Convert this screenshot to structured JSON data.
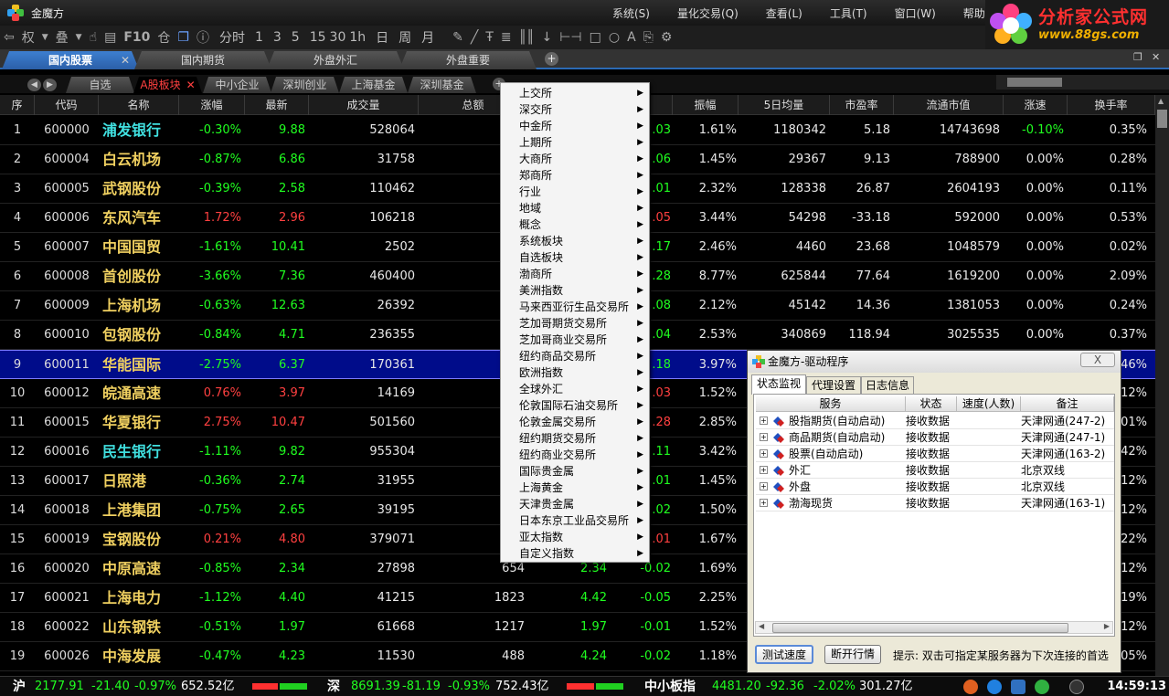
{
  "window": {
    "title": "金魔方"
  },
  "menu": [
    "系统(S)",
    "量化交易(Q)",
    "查看(L)",
    "工具(T)",
    "窗口(W)",
    "帮助"
  ],
  "brand": {
    "name": "分析家公式网",
    "url": "www.88gs.com"
  },
  "toolbar": {
    "left": [
      "权",
      "叠",
      "F10",
      "仓"
    ],
    "periods": [
      "分时",
      "1",
      "3",
      "5",
      "15",
      "30",
      "1h",
      "日",
      "周",
      "月"
    ]
  },
  "main_tabs": [
    {
      "label": "国内股票",
      "active": true
    },
    {
      "label": "国内期货"
    },
    {
      "label": "外盘外汇"
    },
    {
      "label": "外盘重要"
    }
  ],
  "sub_tabs": [
    {
      "label": "自选"
    },
    {
      "label": "A股板块",
      "active": true
    },
    {
      "label": "中小企业"
    },
    {
      "label": "深圳创业"
    },
    {
      "label": "上海基金"
    },
    {
      "label": "深圳基金"
    }
  ],
  "columns": [
    "序",
    "代码",
    "名称",
    "涨幅",
    "最新",
    "成交量",
    "总额",
    "",
    "",
    "振幅",
    "5日均量",
    "市盈率",
    "流通市值",
    "涨速",
    "换手率"
  ],
  "rows": [
    {
      "seq": "1",
      "code": "600000",
      "name": "浦发银行",
      "nc": "cyan",
      "chg": "-0.30%",
      "last": "9.88",
      "vol": "528064",
      "amt": "52",
      "p2": "",
      "d": ".03",
      "amp": "1.61%",
      "avg5": "1180342",
      "pe": "5.18",
      "mv": "14743698",
      "spd": "-0.10%",
      "turn": "0.35%",
      "dir": "g"
    },
    {
      "seq": "2",
      "code": "600004",
      "name": "白云机场",
      "chg": "-0.87%",
      "last": "6.86",
      "vol": "31758",
      "amt": "2",
      "p2": "",
      "d": ".06",
      "amp": "1.45%",
      "avg5": "29367",
      "pe": "9.13",
      "mv": "788900",
      "spd": "0.00%",
      "turn": "0.28%",
      "dir": "g"
    },
    {
      "seq": "3",
      "code": "600005",
      "name": "武钢股份",
      "chg": "-0.39%",
      "last": "2.58",
      "vol": "110462",
      "amt": "2",
      "p2": "",
      "d": ".01",
      "amp": "2.32%",
      "avg5": "128338",
      "pe": "26.87",
      "mv": "2604193",
      "spd": "0.00%",
      "turn": "0.11%",
      "dir": "g"
    },
    {
      "seq": "4",
      "code": "600006",
      "name": "东风汽车",
      "chg": "1.72%",
      "last": "2.96",
      "vol": "106218",
      "amt": "3",
      "p2": "",
      "d": ".05",
      "amp": "3.44%",
      "avg5": "54298",
      "pe": "-33.18",
      "mv": "592000",
      "spd": "0.00%",
      "turn": "0.53%",
      "dir": "rd"
    },
    {
      "seq": "5",
      "code": "600007",
      "name": "中国国贸",
      "chg": "-1.61%",
      "last": "10.41",
      "vol": "2502",
      "amt": "",
      "p2": "",
      "d": ".17",
      "amp": "2.46%",
      "avg5": "4460",
      "pe": "23.68",
      "mv": "1048579",
      "spd": "0.00%",
      "turn": "0.02%",
      "dir": "g"
    },
    {
      "seq": "6",
      "code": "600008",
      "name": "首创股份",
      "chg": "-3.66%",
      "last": "7.36",
      "vol": "460400",
      "amt": "34",
      "p2": "",
      "d": ".28",
      "amp": "8.77%",
      "avg5": "625844",
      "pe": "77.64",
      "mv": "1619200",
      "spd": "0.00%",
      "turn": "2.09%",
      "dir": "g"
    },
    {
      "seq": "7",
      "code": "600009",
      "name": "上海机场",
      "chg": "-0.63%",
      "last": "12.63",
      "vol": "26392",
      "amt": "3",
      "p2": "",
      "d": ".08",
      "amp": "2.12%",
      "avg5": "45142",
      "pe": "14.36",
      "mv": "1381053",
      "spd": "0.00%",
      "turn": "0.24%",
      "dir": "g"
    },
    {
      "seq": "8",
      "code": "600010",
      "name": "包钢股份",
      "chg": "-0.84%",
      "last": "4.71",
      "vol": "236355",
      "amt": "11",
      "p2": "",
      "d": ".04",
      "amp": "2.53%",
      "avg5": "340869",
      "pe": "118.94",
      "mv": "3025535",
      "spd": "0.00%",
      "turn": "0.37%",
      "dir": "g"
    },
    {
      "seq": "9",
      "code": "600011",
      "name": "华能国际",
      "chg": "-2.75%",
      "last": "6.37",
      "vol": "170361",
      "amt": "10",
      "p2": "",
      "d": ".18",
      "amp": "3.97%",
      "avg5": "",
      "pe": "",
      "mv": "",
      "spd": "",
      "turn": "46%",
      "dir": "g",
      "sel": true
    },
    {
      "seq": "10",
      "code": "600012",
      "name": "皖通高速",
      "chg": "0.76%",
      "last": "3.97",
      "vol": "14169",
      "amt": "",
      "p2": "",
      "d": ".03",
      "amp": "1.52%",
      "avg5": "",
      "pe": "",
      "mv": "",
      "spd": "",
      "turn": "12%",
      "dir": "rd"
    },
    {
      "seq": "11",
      "code": "600015",
      "name": "华夏银行",
      "chg": "2.75%",
      "last": "10.47",
      "vol": "501560",
      "amt": "52",
      "p2": "",
      "d": ".28",
      "amp": "2.85%",
      "avg5": "",
      "pe": "",
      "mv": "",
      "spd": "",
      "turn": "01%",
      "dir": "rd"
    },
    {
      "seq": "12",
      "code": "600016",
      "name": "民生银行",
      "nc": "cyan",
      "chg": "-1.11%",
      "last": "9.82",
      "vol": "955304",
      "amt": "94",
      "p2": "",
      "d": ".11",
      "amp": "3.42%",
      "avg5": "",
      "pe": "",
      "mv": "",
      "spd": "",
      "turn": "42%",
      "dir": "g"
    },
    {
      "seq": "13",
      "code": "600017",
      "name": "日照港",
      "chg": "-0.36%",
      "last": "2.74",
      "vol": "31955",
      "amt": "",
      "p2": "",
      "d": ".01",
      "amp": "1.45%",
      "avg5": "",
      "pe": "",
      "mv": "",
      "spd": "",
      "turn": "12%",
      "dir": "g"
    },
    {
      "seq": "14",
      "code": "600018",
      "name": "上港集团",
      "chg": "-0.75%",
      "last": "2.65",
      "vol": "39195",
      "amt": "1",
      "p2": "",
      "d": ".02",
      "amp": "1.50%",
      "avg5": "",
      "pe": "",
      "mv": "",
      "spd": "",
      "turn": "12%",
      "dir": "g"
    },
    {
      "seq": "15",
      "code": "600019",
      "name": "宝钢股份",
      "chg": "0.21%",
      "last": "4.80",
      "vol": "379071",
      "amt": "18",
      "p2": "",
      "d": ".01",
      "amp": "1.67%",
      "avg5": "",
      "pe": "",
      "mv": "",
      "spd": "",
      "turn": "22%",
      "dir": "rd"
    },
    {
      "seq": "16",
      "code": "600020",
      "name": "中原高速",
      "chg": "-0.85%",
      "last": "2.34",
      "vol": "27898",
      "amt": "654",
      "p2": "2.34",
      "d": "-0.02",
      "amp": "1.69%",
      "avg5": "",
      "pe": "",
      "mv": "",
      "spd": "",
      "turn": "12%",
      "dir": "g"
    },
    {
      "seq": "17",
      "code": "600021",
      "name": "上海电力",
      "chg": "-1.12%",
      "last": "4.40",
      "vol": "41215",
      "amt": "1823",
      "p2": "4.42",
      "d": "-0.05",
      "amp": "2.25%",
      "avg5": "",
      "pe": "",
      "mv": "",
      "spd": "",
      "turn": "19%",
      "dir": "g"
    },
    {
      "seq": "18",
      "code": "600022",
      "name": "山东钢铁",
      "chg": "-0.51%",
      "last": "1.97",
      "vol": "61668",
      "amt": "1217",
      "p2": "1.97",
      "d": "-0.01",
      "amp": "1.52%",
      "avg5": "",
      "pe": "",
      "mv": "",
      "spd": "",
      "turn": "12%",
      "dir": "g"
    },
    {
      "seq": "19",
      "code": "600026",
      "name": "中海发展",
      "chg": "-0.47%",
      "last": "4.23",
      "vol": "11530",
      "amt": "488",
      "p2": "4.24",
      "d": "-0.02",
      "amp": "1.18%",
      "avg5": "",
      "pe": "",
      "mv": "",
      "spd": "",
      "turn": "05%",
      "dir": "g"
    }
  ],
  "context_menu": [
    "上交所",
    "深交所",
    "中金所",
    "上期所",
    "大商所",
    "郑商所",
    "行业",
    "地域",
    "概念",
    "系统板块",
    "自选板块",
    "渤商所",
    "美洲指数",
    "马来西亚衍生品交易所",
    "芝加哥期货交易所",
    "芝加哥商业交易所",
    "纽约商品交易所",
    "欧洲指数",
    "全球外汇",
    "伦敦国际石油交易所",
    "伦敦金属交易所",
    "纽约期货交易所",
    "纽约商业交易所",
    "国际贵金属",
    "上海黄金",
    "天津贵金属",
    "日本东京工业品交易所",
    "亚太指数",
    "自定义指数"
  ],
  "dialog": {
    "title": "金魔方-驱动程序",
    "close": "X",
    "tabs": [
      "状态监视",
      "代理设置",
      "日志信息"
    ],
    "headers": [
      "服务",
      "状态",
      "速度(人数)",
      "备注"
    ],
    "rows": [
      {
        "service": "股指期货(自动启动)",
        "status": "接收数据",
        "note": "天津网通(247-2)"
      },
      {
        "service": "商品期货(自动启动)",
        "status": "接收数据",
        "note": "天津网通(247-1)"
      },
      {
        "service": "股票(自动启动)",
        "status": "接收数据",
        "note": "天津网通(163-2)"
      },
      {
        "service": "外汇",
        "status": "接收数据",
        "note": "北京双线"
      },
      {
        "service": "外盘",
        "status": "接收数据",
        "note": "北京双线"
      },
      {
        "service": "渤海现货",
        "status": "接收数据",
        "note": "天津网通(163-1)"
      }
    ],
    "btn_test": "测试速度",
    "btn_disconnect": "断开行情",
    "hint": "提示: 双击可指定某服务器为下次连接的首选"
  },
  "status": {
    "sh": {
      "label": "沪",
      "index": "2177.91",
      "chg": "-21.40",
      "pct": "-0.97%",
      "amt": "652.52亿"
    },
    "sz": {
      "label": "深",
      "index": "8691.39",
      "chg": "-81.19",
      "pct": "-0.93%",
      "amt": "752.43亿"
    },
    "sme": {
      "label": "中小板指",
      "index": "4481.20",
      "chg": "-92.36",
      "pct": "-2.02%",
      "amt": "301.27亿"
    },
    "time": "14:59:13"
  },
  "colors": {
    "up": "#ff4040",
    "down": "#20ff20",
    "name": "#f0d060",
    "accent": "#2b6ab5"
  }
}
